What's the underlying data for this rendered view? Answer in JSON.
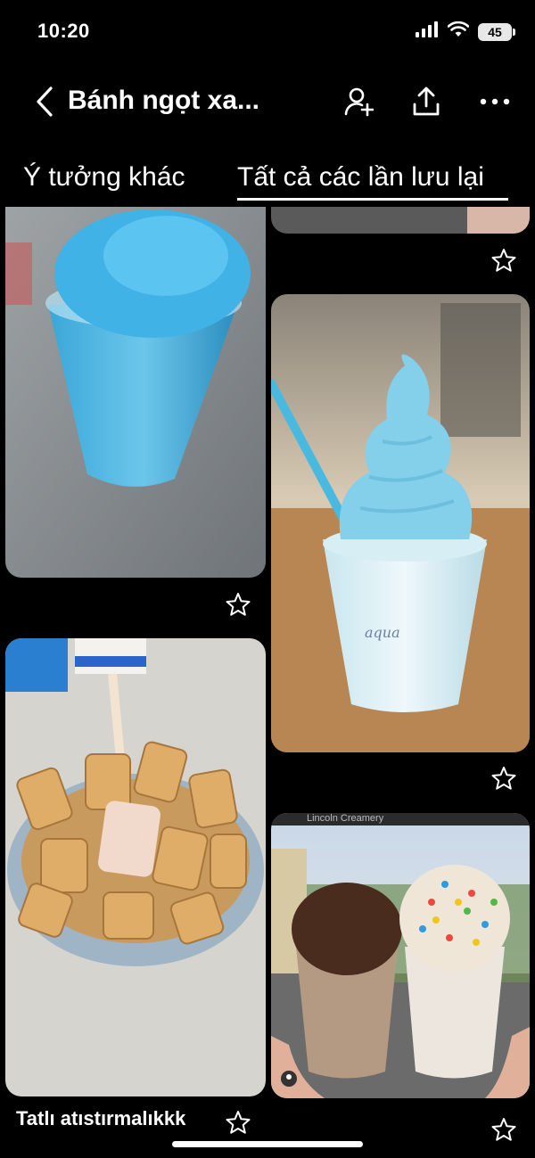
{
  "status_bar": {
    "time": "10:20",
    "battery": "45"
  },
  "header": {
    "title": "Bánh ngọt xa..."
  },
  "tabs": [
    {
      "label": "Ý tưởng khác",
      "active": false
    },
    {
      "label": "Tất cả các lần lưu lại",
      "active": true
    }
  ],
  "pins": [
    {
      "description": "blue shaved ice in plastic cup"
    },
    {
      "description": "blue soft serve ice cream cup"
    },
    {
      "description": "biscuits in bowl with condensed milk"
    },
    {
      "description": "chocolate and rainbow sprinkle sundaes",
      "overlay_text": "Lincoln Creamery"
    }
  ],
  "pin_caption": "Tatlı atıstırmalıkkk",
  "colors": {
    "background": "#000000",
    "text": "#ffffff"
  }
}
